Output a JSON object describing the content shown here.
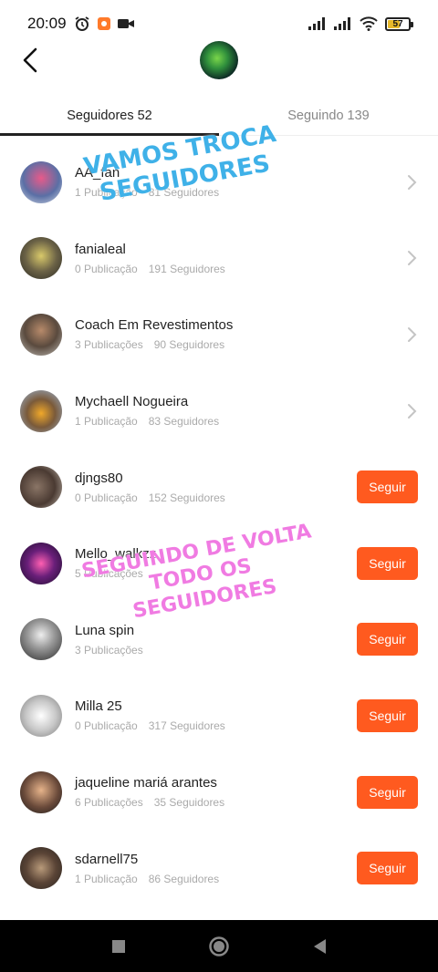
{
  "status_bar": {
    "time": "20:09",
    "battery": "57",
    "battery_level": 0.57,
    "battery_color": "#e8b92b"
  },
  "tabs": [
    {
      "label": "Seguidores 52",
      "active": true
    },
    {
      "label": "Seguindo 139",
      "active": false
    }
  ],
  "overlays": {
    "top": [
      "VAMOS TROCA",
      "SEGUIDORES"
    ],
    "middle": [
      "SEGUINDO DE VOLTA",
      "TODO OS",
      "SEGUIDORES"
    ]
  },
  "follow_label": "Seguir",
  "accent_color": "#ff5a1f",
  "users": [
    {
      "name": "AA_fan",
      "posts": "1 Publicação",
      "followers": "81 Seguidores",
      "action": "chevron"
    },
    {
      "name": "fanialeal",
      "posts": "0 Publicação",
      "followers": "191 Seguidores",
      "action": "chevron"
    },
    {
      "name": "Coach Em Revestimentos",
      "posts": "3 Publicações",
      "followers": "90 Seguidores",
      "action": "chevron"
    },
    {
      "name": "Mychaell Nogueira",
      "posts": "1 Publicação",
      "followers": "83 Seguidores",
      "action": "chevron"
    },
    {
      "name": "djngs80",
      "posts": "0 Publicação",
      "followers": "152 Seguidores",
      "action": "follow"
    },
    {
      "name": "Mello_walkzz",
      "posts": "5 Publicações",
      "followers": "",
      "action": "follow"
    },
    {
      "name": "Luna spin",
      "posts": "3 Publicações",
      "followers": "",
      "action": "follow"
    },
    {
      "name": "Milla 25",
      "posts": "0 Publicação",
      "followers": "317 Seguidores",
      "action": "follow"
    },
    {
      "name": "jaqueline mariá arantes",
      "posts": "6 Publicações",
      "followers": "35 Seguidores",
      "action": "follow"
    },
    {
      "name": "sdarnell75",
      "posts": "1 Publicação",
      "followers": "86 Seguidores",
      "action": "follow"
    }
  ]
}
